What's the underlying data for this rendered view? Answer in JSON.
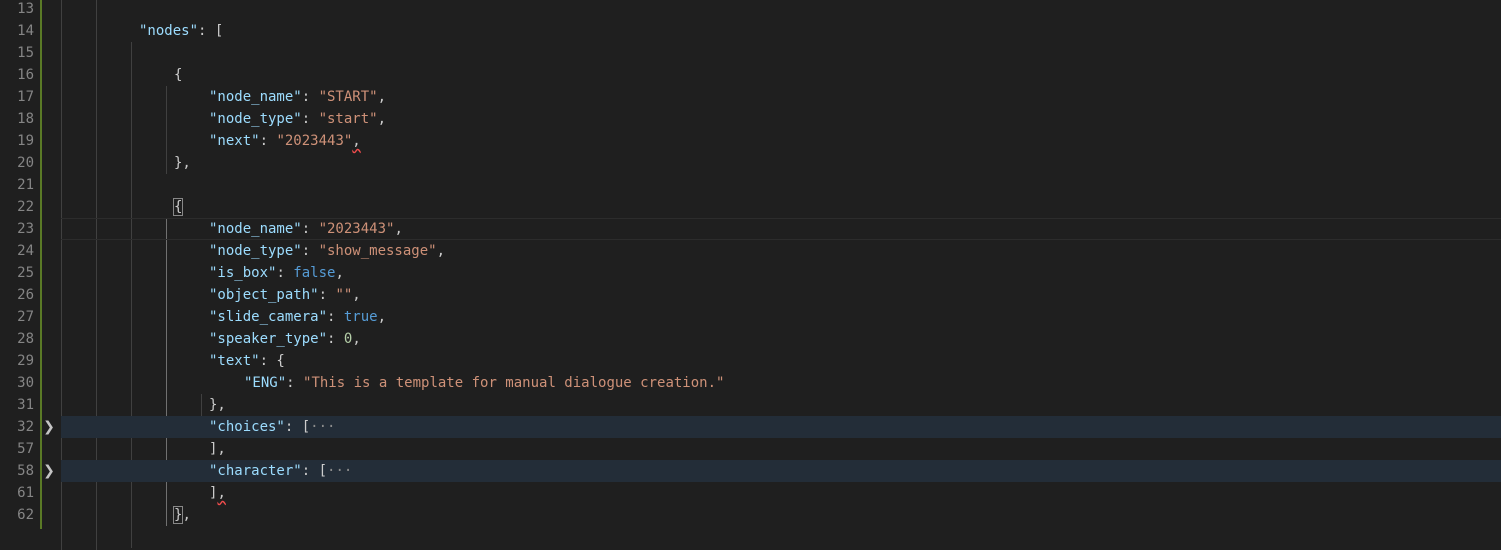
{
  "editor": {
    "lines": [
      {
        "num": "13",
        "indent": 0,
        "tokens": []
      },
      {
        "num": "14",
        "indent": 2,
        "tokens": [
          {
            "t": "\"nodes\"",
            "c": "k"
          },
          {
            "t": ": [",
            "c": "p"
          }
        ]
      },
      {
        "num": "15",
        "indent": 0,
        "tokens": []
      },
      {
        "num": "16",
        "indent": 3,
        "tokens": [
          {
            "t": "{",
            "c": "p"
          }
        ]
      },
      {
        "num": "17",
        "indent": 4,
        "tokens": [
          {
            "t": "\"node_name\"",
            "c": "k"
          },
          {
            "t": ": ",
            "c": "p"
          },
          {
            "t": "\"START\"",
            "c": "s"
          },
          {
            "t": ",",
            "c": "p"
          }
        ]
      },
      {
        "num": "18",
        "indent": 4,
        "tokens": [
          {
            "t": "\"node_type\"",
            "c": "k"
          },
          {
            "t": ": ",
            "c": "p"
          },
          {
            "t": "\"start\"",
            "c": "s"
          },
          {
            "t": ",",
            "c": "p"
          }
        ]
      },
      {
        "num": "19",
        "indent": 4,
        "tokens": [
          {
            "t": "\"next\"",
            "c": "k"
          },
          {
            "t": ": ",
            "c": "p"
          },
          {
            "t": "\"2023443\"",
            "c": "s"
          },
          {
            "t": ",",
            "c": "p squig"
          }
        ]
      },
      {
        "num": "20",
        "indent": 3,
        "tokens": [
          {
            "t": "},",
            "c": "p"
          }
        ]
      },
      {
        "num": "21",
        "indent": 0,
        "tokens": []
      },
      {
        "num": "22",
        "indent": 3,
        "tokens": [
          {
            "t": "{",
            "c": "p bracket-match"
          }
        ]
      },
      {
        "num": "23",
        "indent": 4,
        "current": true,
        "tokens": [
          {
            "t": "\"node_name\"",
            "c": "k"
          },
          {
            "t": ": ",
            "c": "p"
          },
          {
            "t": "\"2023443\"",
            "c": "s"
          },
          {
            "t": ",",
            "c": "p"
          }
        ]
      },
      {
        "num": "24",
        "indent": 4,
        "tokens": [
          {
            "t": "\"node_type\"",
            "c": "k"
          },
          {
            "t": ": ",
            "c": "p"
          },
          {
            "t": "\"show_message\"",
            "c": "s"
          },
          {
            "t": ",",
            "c": "p"
          }
        ]
      },
      {
        "num": "25",
        "indent": 4,
        "tokens": [
          {
            "t": "\"is_box\"",
            "c": "k"
          },
          {
            "t": ": ",
            "c": "p"
          },
          {
            "t": "false",
            "c": "b"
          },
          {
            "t": ",",
            "c": "p"
          }
        ]
      },
      {
        "num": "26",
        "indent": 4,
        "tokens": [
          {
            "t": "\"object_path\"",
            "c": "k"
          },
          {
            "t": ": ",
            "c": "p"
          },
          {
            "t": "\"\"",
            "c": "s"
          },
          {
            "t": ",",
            "c": "p"
          }
        ]
      },
      {
        "num": "27",
        "indent": 4,
        "tokens": [
          {
            "t": "\"slide_camera\"",
            "c": "k"
          },
          {
            "t": ": ",
            "c": "p"
          },
          {
            "t": "true",
            "c": "b"
          },
          {
            "t": ",",
            "c": "p"
          }
        ]
      },
      {
        "num": "28",
        "indent": 4,
        "tokens": [
          {
            "t": "\"speaker_type\"",
            "c": "k"
          },
          {
            "t": ": ",
            "c": "p"
          },
          {
            "t": "0",
            "c": "n"
          },
          {
            "t": ",",
            "c": "p"
          }
        ]
      },
      {
        "num": "29",
        "indent": 4,
        "tokens": [
          {
            "t": "\"text\"",
            "c": "k"
          },
          {
            "t": ": {",
            "c": "p"
          }
        ]
      },
      {
        "num": "30",
        "indent": 5,
        "tokens": [
          {
            "t": "\"ENG\"",
            "c": "k"
          },
          {
            "t": ": ",
            "c": "p"
          },
          {
            "t": "\"This is a template for manual dialogue creation.\"",
            "c": "s"
          }
        ]
      },
      {
        "num": "31",
        "indent": 4,
        "tokens": [
          {
            "t": "},",
            "c": "p"
          }
        ]
      },
      {
        "num": "32",
        "indent": 4,
        "folded": true,
        "fold": "chevron-right",
        "tokens": [
          {
            "t": "\"choices\"",
            "c": "k"
          },
          {
            "t": ": [",
            "c": "p"
          },
          {
            "t": "···",
            "c": "dots"
          }
        ]
      },
      {
        "num": "57",
        "indent": 4,
        "tokens": [
          {
            "t": "],",
            "c": "p"
          }
        ]
      },
      {
        "num": "58",
        "indent": 4,
        "folded": true,
        "fold": "chevron-right",
        "tokens": [
          {
            "t": "\"character\"",
            "c": "k"
          },
          {
            "t": ": [",
            "c": "p"
          },
          {
            "t": "···",
            "c": "dots"
          }
        ]
      },
      {
        "num": "61",
        "indent": 4,
        "tokens": [
          {
            "t": "]",
            "c": "p"
          },
          {
            "t": ",",
            "c": "p squig"
          }
        ]
      },
      {
        "num": "62",
        "indent": 3,
        "tokens": [
          {
            "t": "}",
            "c": "p bracket-match"
          },
          {
            "t": ",",
            "c": "p"
          }
        ]
      }
    ]
  }
}
